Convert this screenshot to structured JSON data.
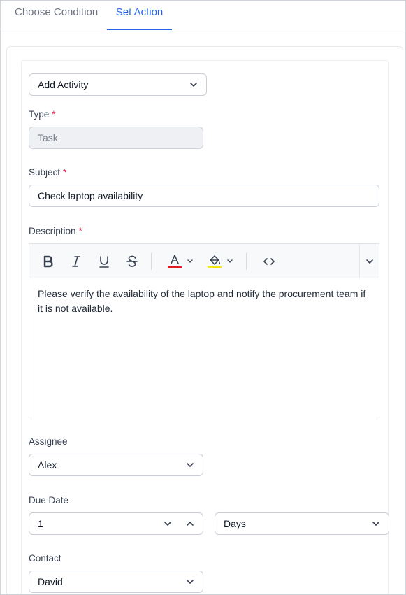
{
  "tabs": [
    {
      "label": "Choose Condition",
      "active": false
    },
    {
      "label": "Set Action",
      "active": true
    }
  ],
  "action_select": {
    "value": "Add Activity"
  },
  "type": {
    "label": "Type",
    "required_mark": "*",
    "value": "Task"
  },
  "subject": {
    "label": "Subject",
    "required_mark": "*",
    "value": "Check laptop availability"
  },
  "description": {
    "label": "Description",
    "required_mark": "*",
    "text": "Please verify the availability of the laptop and notify the procurement team if it is not available.",
    "toolbar": {
      "icons": [
        "bold-icon",
        "italic-icon",
        "underline-icon",
        "strikethrough-icon",
        "font-color-icon",
        "background-color-icon",
        "source-code-icon",
        "more-chevron-icon"
      ],
      "font_color_swatch": "#e11d24",
      "background_color_swatch": "#f5e60f"
    }
  },
  "assignee": {
    "label": "Assignee",
    "value": "Alex"
  },
  "due_date": {
    "label": "Due Date",
    "amount": "1",
    "unit": "Days"
  },
  "contact": {
    "label": "Contact",
    "value": "David"
  },
  "colors": {
    "accent": "#2563eb",
    "required": "#e11d48"
  }
}
